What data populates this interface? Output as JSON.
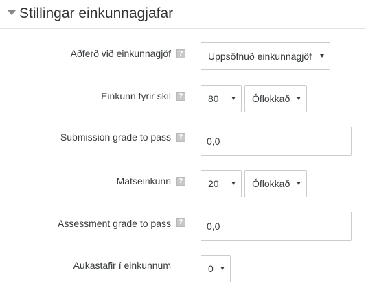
{
  "section": {
    "title": "Stillingar einkunnagjafar",
    "toggle_icon": "chevron-down-icon"
  },
  "help_icon": {
    "name": "help-icon",
    "glyph": "?"
  },
  "fields": {
    "grading_method": {
      "label": "Aðferð við einkunnagjöf",
      "value": "Uppsöfnuð einkunnagjöf"
    },
    "submission_grade": {
      "label": "Einkunn fyrir skil",
      "value": "80",
      "category": "Óflokkað"
    },
    "submission_grade_to_pass": {
      "label": "Submission grade to pass",
      "value": "0,0"
    },
    "assessment_grade": {
      "label": "Matseinkunn",
      "value": "20",
      "category": "Óflokkað"
    },
    "assessment_grade_to_pass": {
      "label": "Assessment grade to pass",
      "value": "0,0"
    },
    "decimal_places": {
      "label": "Aukastafir í einkunnum",
      "value": "0"
    }
  }
}
